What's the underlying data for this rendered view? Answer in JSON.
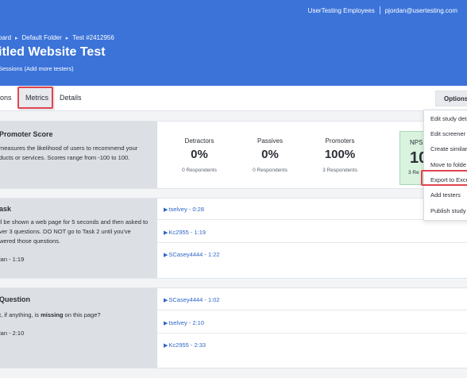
{
  "header": {
    "org": "UserTesting Employees",
    "user_email": "pjordan@usertesting.com",
    "breadcrumbs": [
      "oard",
      "Default Folder",
      "Test #2412956"
    ],
    "title": "itled Website Test",
    "subline": "Sessions  (Add more testers)"
  },
  "tabs": [
    {
      "label": "ions"
    },
    {
      "label": "Metrics"
    },
    {
      "label": "Details"
    }
  ],
  "options_label": "Options",
  "options_menu": [
    "Edit study deta",
    "Edit screener",
    "Create similar",
    "Move to folde",
    "Export to Exce",
    "Add testers",
    "Publish study"
  ],
  "nps_card": {
    "title": "Promoter Score",
    "description_lines": [
      "measures the likelihood of users to recommend your",
      "ducts or services. Scores range from -100 to 100."
    ],
    "stats": [
      {
        "label": "Detractors",
        "value": "0%",
        "respondents": "0 Respondents"
      },
      {
        "label": "Passives",
        "value": "0%",
        "respondents": "0 Respondents"
      },
      {
        "label": "Promoters",
        "value": "100%",
        "respondents": "3 Respondents"
      }
    ],
    "nps": {
      "label": "NPS",
      "value": "10",
      "respondents": "3 Re"
    }
  },
  "task_card": {
    "title": "ask",
    "description_lines": [
      "ll be shown a web page for 5 seconds and then asked to",
      "ver 3 questions. DO NOT go to Task 2 until you've",
      "wered those questions."
    ],
    "median": "ian - 1:19",
    "sessions": [
      "tselvey - 0:28",
      "Kc2955 - 1:19",
      "SCasey4444 - 1:22"
    ]
  },
  "question_card": {
    "title": "Question",
    "desc_pre": "t, if anything, is ",
    "desc_bold": "missing",
    "desc_post": " on this page?",
    "median": "ian - 2:10",
    "sessions": [
      "SCasey4444 - 1:02",
      "tselvey - 2:10",
      "Kc2955 - 2:33"
    ]
  },
  "colors": {
    "brand": "#3b73d9",
    "highlight": "#e0454f",
    "link": "#2f66c7",
    "nps_bg": "#d9f3df"
  }
}
